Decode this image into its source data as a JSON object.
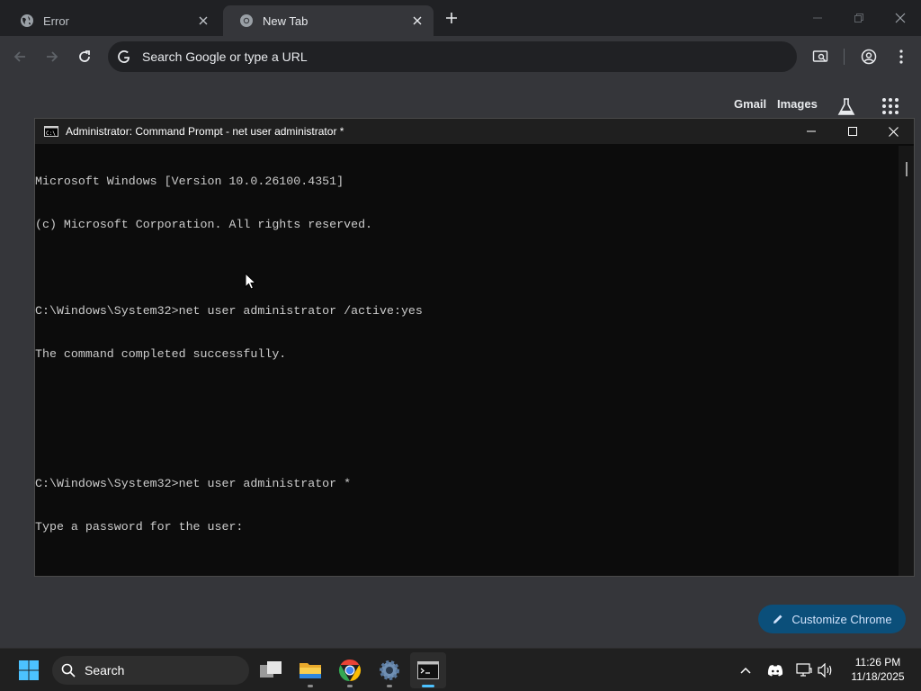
{
  "browser": {
    "tabs": [
      {
        "title": "Error",
        "icon": "globe-icon",
        "active": false
      },
      {
        "title": "New Tab",
        "icon": "chrome-icon",
        "active": true
      }
    ],
    "omnibox_placeholder": "Search Google or type a URL",
    "ntp": {
      "gmail": "Gmail",
      "images": "Images",
      "customize_label": "Customize Chrome"
    }
  },
  "cmd": {
    "title": "Administrator: Command Prompt - net  user administrator *",
    "lines": [
      "Microsoft Windows [Version 10.0.26100.4351]",
      "(c) Microsoft Corporation. All rights reserved.",
      "",
      "C:\\Windows\\System32>net user administrator /active:yes",
      "The command completed successfully.",
      "",
      "",
      "C:\\Windows\\System32>net user administrator *",
      "Type a password for the user:"
    ]
  },
  "taskbar": {
    "search_label": "Search",
    "apps": [
      "task-view-icon",
      "file-explorer-icon",
      "chrome-icon",
      "settings-icon",
      "terminal-icon"
    ],
    "time": "11:26 PM",
    "date": "11/18/2025"
  },
  "colors": {
    "chrome_frame": "#202124",
    "chrome_toolbar": "#35363a",
    "console_bg": "#0c0c0c",
    "console_text": "#cccccc",
    "customize_bg": "#0b4f7a",
    "taskbar_bg": "#202020",
    "windows_accent": "#4cc2ff"
  }
}
